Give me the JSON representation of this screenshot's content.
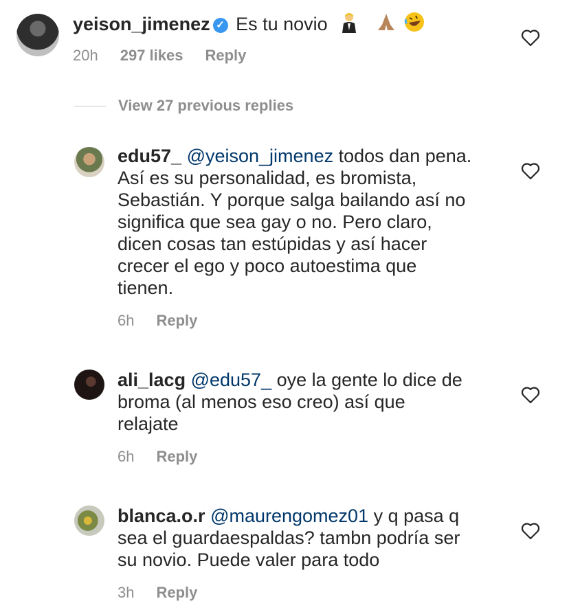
{
  "main_comment": {
    "username": "yeison_jimenez",
    "text": "Es tu novio",
    "emoji_icons": [
      "person-in-tuxedo-emoji",
      "folded-hands-emoji",
      "rolling-laughing-emoji"
    ],
    "time": "20h",
    "likes": "297 likes",
    "reply": "Reply"
  },
  "view_previous": "View 27 previous replies",
  "replies": [
    {
      "username": "edu57_",
      "mention": "@yeison_jimenez",
      "lines": [
        "todos dan pena.",
        "Así es su personalidad, es bromista,",
        "Sebastián. Y porque salga bailando así no",
        "significa que sea gay o no. Pero claro,",
        "dicen cosas tan estúpidas y así hacer",
        "crecer el ego y poco autoestima que",
        "tienen."
      ],
      "time": "6h",
      "reply": "Reply"
    },
    {
      "username": "ali_lacg",
      "mention": "@edu57_",
      "lines": [
        "oye la gente lo dice de",
        "broma (al menos eso creo) así que",
        "relajate"
      ],
      "time": "6h",
      "reply": "Reply"
    },
    {
      "username": "blanca.o.r",
      "mention": "@maurengomez01",
      "lines": [
        "y q pasa q",
        "sea el guardaespaldas? tambn podría ser",
        "su novio. Puede valer para todo"
      ],
      "time": "3h",
      "reply": "Reply"
    }
  ],
  "colors": {
    "text": "#262626",
    "mention": "#00376b",
    "meta": "#8e8e8e",
    "verified": "#3897f0"
  }
}
